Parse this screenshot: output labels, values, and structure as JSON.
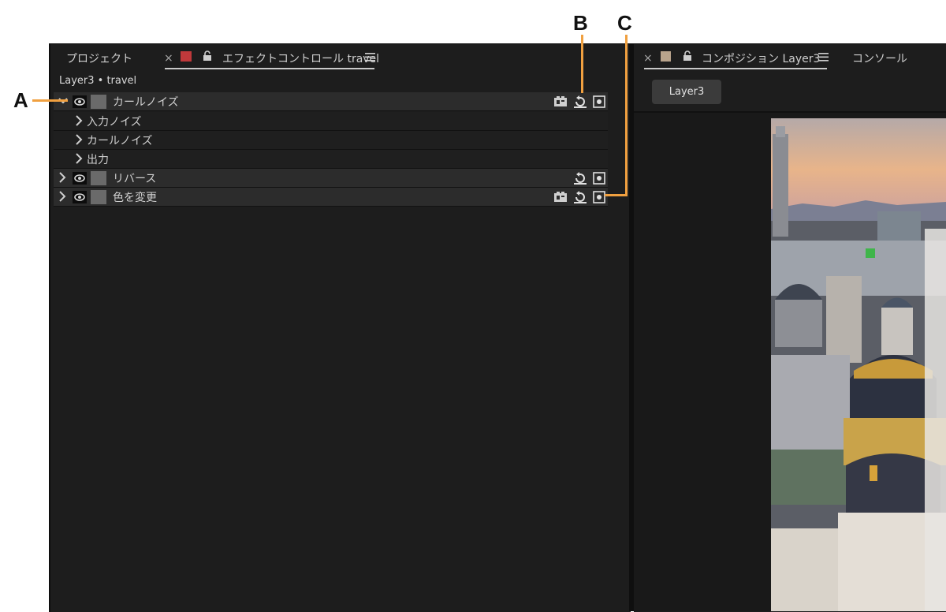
{
  "left_panel": {
    "tab_project": "プロジェクト",
    "tab_effect_controls": "エフェクトコントロール travel",
    "breadcrumb": "Layer3 • travel"
  },
  "effects": [
    {
      "name": "カールノイズ",
      "expanded": true,
      "sub_items": [
        "入力ノイズ",
        "カールノイズ",
        "出力"
      ],
      "has_compositing_icon": true
    },
    {
      "name": "リバース",
      "expanded": false,
      "has_compositing_icon": false
    },
    {
      "name": "色を変更",
      "expanded": false,
      "has_compositing_icon": true
    }
  ],
  "right_panel": {
    "tab_composition": "コンポジション Layer3",
    "tab_console": "コンソール",
    "layer_button": "Layer3"
  },
  "callouts": {
    "a": "A",
    "b": "B",
    "c": "C"
  },
  "colors": {
    "accent_orange": "#f0a040",
    "effect_tab_swatch": "#c0393b",
    "comp_tab_swatch": "#b9a48c"
  }
}
